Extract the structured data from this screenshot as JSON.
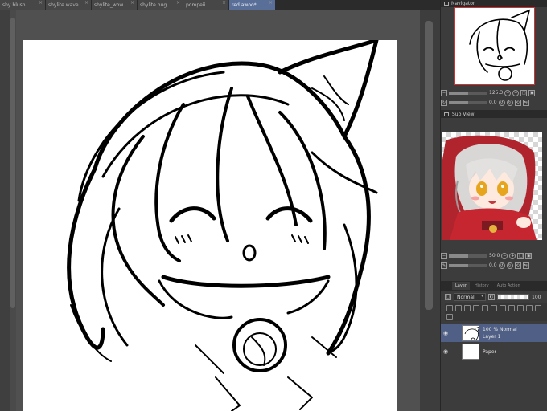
{
  "tabs": [
    {
      "label": "shy blush",
      "active": false
    },
    {
      "label": "shylite wave",
      "active": false
    },
    {
      "label": "shylite_wow",
      "active": false
    },
    {
      "label": "shylite hug",
      "active": false
    },
    {
      "label": "pompeii",
      "active": false
    },
    {
      "label": "red awoo*",
      "active": true
    }
  ],
  "navigator": {
    "title": "Navigator",
    "zoom": "125.3",
    "angle": "0.0"
  },
  "subview": {
    "title": "Sub View",
    "zoom": "50.0",
    "angle": "0.0"
  },
  "layer_panel": {
    "tabs": [
      "Layer",
      "History",
      "Auto Action"
    ],
    "blend_mode": "Normal",
    "opacity": "100",
    "layers": [
      {
        "name": "Layer 1",
        "detail": "100 % Normal",
        "selected": true
      },
      {
        "name": "Paper",
        "detail": "",
        "selected": false
      }
    ]
  },
  "colors": {
    "active_tab": "#5a6f98",
    "selected_layer": "#4f5f85",
    "panel_bg": "#3c3c3c",
    "canvas_bg": "#ffffff"
  }
}
